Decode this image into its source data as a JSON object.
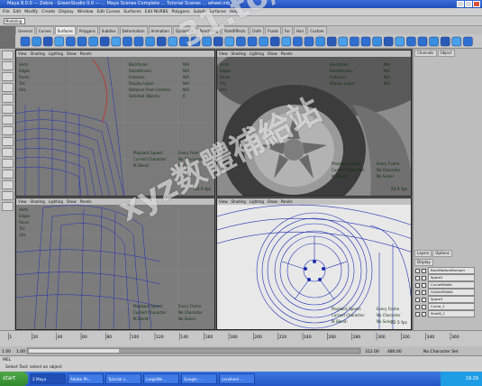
{
  "title": "Maya 8.0.0 — Zebra · GreenStudio 0.0 — ... Maya Scenes Complete ... Tutorial Scenes ... wheel.mb",
  "menus": [
    "File",
    "Edit",
    "Modify",
    "Create",
    "Display",
    "Window",
    "Edit Curves",
    "Surfaces",
    "Edit NURBS",
    "Polygons",
    "Subdiv Surfaces",
    "Help"
  ],
  "mode": "Modeling",
  "shelf_tabs": [
    "General",
    "Curves",
    "Surfaces",
    "Polygons",
    "Subdivs",
    "Deformation",
    "Animation",
    "Dynamics",
    "Rendering",
    "PaintEffects",
    "Cloth",
    "Fluids",
    "Fur",
    "Hair",
    "Custom"
  ],
  "shelf_active": "Surfaces",
  "viewport_menu": [
    "View",
    "Shading",
    "Lighting",
    "Show",
    "Panels"
  ],
  "hud_left": [
    "Verts",
    "Edges",
    "Faces",
    "Tris",
    "UVs"
  ],
  "hud_cols": [
    "0",
    "0",
    "0"
  ],
  "hud_right": [
    {
      "label": "Backfaces:",
      "value": "N/A"
    },
    {
      "label": "Smoothness:",
      "value": "N/A"
    },
    {
      "label": "Instance:",
      "value": "N/A"
    },
    {
      "label": "Display Layer:",
      "value": "N/A"
    },
    {
      "label": "Distance From Camera:",
      "value": "N/A"
    },
    {
      "label": "Selected Objects:",
      "value": "0"
    }
  ],
  "hud_bottom": [
    {
      "label": "Playback Speed:",
      "value": "Every Frame"
    },
    {
      "label": "Current Character:",
      "value": "No Character"
    },
    {
      "label": "IK Blend:",
      "value": "No Solver"
    }
  ],
  "fps": "22.5 fps",
  "channel_tabs": [
    "Channels",
    "Object"
  ],
  "layer_tabs": [
    "Layers",
    "Options"
  ],
  "layer_display": "Display",
  "layers": [
    "BackBottomBumper",
    "Spare2",
    "CurveMiddle",
    "GutterMiddle",
    "Spare3",
    "Curve_1",
    "Shell8_1"
  ],
  "timeline_ticks": [
    "1",
    "20",
    "40",
    "60",
    "80",
    "100",
    "120",
    "140",
    "160",
    "180",
    "200",
    "220",
    "240",
    "260",
    "280",
    "300",
    "320",
    "340",
    "360"
  ],
  "range": {
    "start": "1.00",
    "inner_start": "1.00",
    "inner_end": "312.00",
    "end": "480.00",
    "character": "No Character Set"
  },
  "cmd": "MEL",
  "help": "Select Tool: select an object",
  "taskbar": {
    "start": "start",
    "items": [
      "2 Maya",
      "Adobe Ph...",
      "Tutorial s...",
      "LargeWe...",
      "Google - ...",
      "carwheel ..."
    ],
    "time": "19:29"
  },
  "watermark": [
    "xyz数體補給站",
    "31.to/xyz"
  ],
  "colors": {
    "wire": "#1f2fb0",
    "grid": "#8a8a8a",
    "title": "#2a5ad0"
  }
}
